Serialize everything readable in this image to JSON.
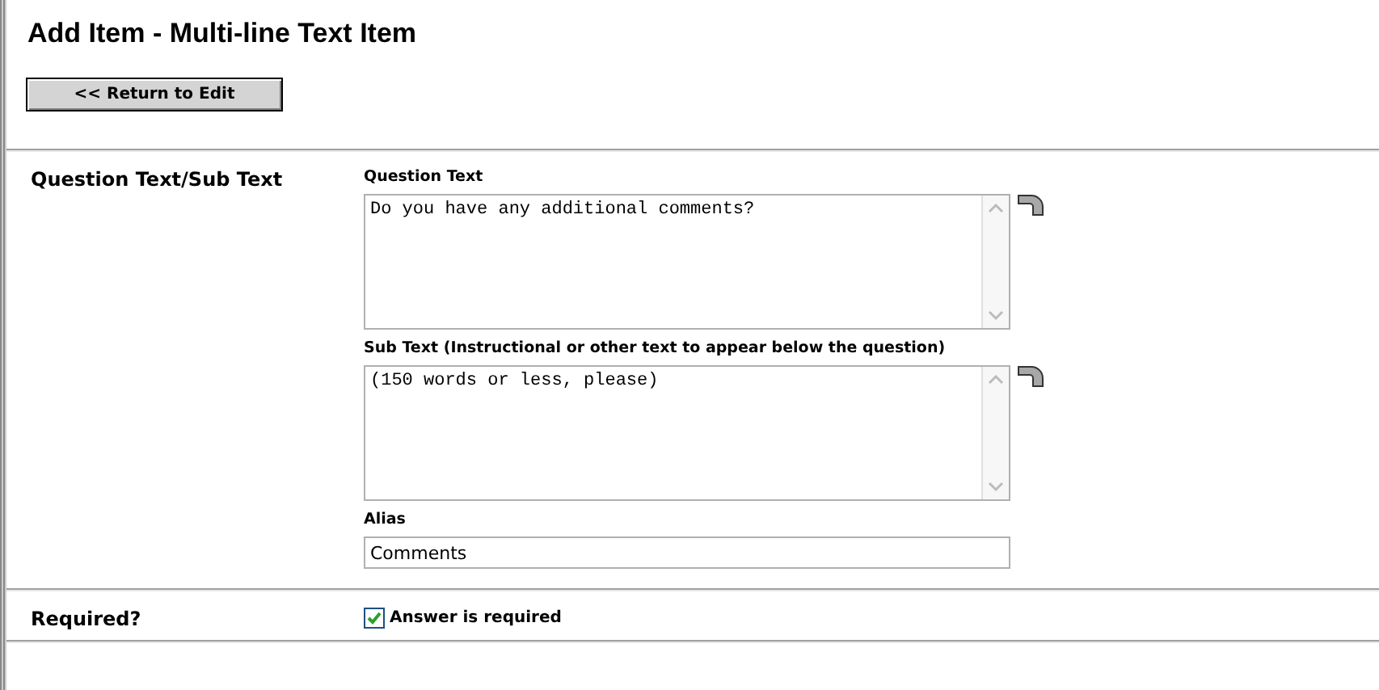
{
  "title": "Add Item - Multi-line Text Item",
  "return_button": "<< Return to Edit",
  "sections": [
    {
      "label": "Question Text/Sub Text",
      "fields": [
        {
          "kind": "textarea",
          "label": "Question Text",
          "value": "Do you have any additional comments?"
        },
        {
          "kind": "textarea",
          "label": "Sub Text (Instructional or other text to appear below the question)",
          "value": "(150 words or less, please)"
        },
        {
          "kind": "input",
          "label": "Alias",
          "value": "Comments"
        }
      ]
    },
    {
      "label": "Required?",
      "fields": [
        {
          "kind": "checkbox",
          "label": "Answer is required",
          "checked": true
        }
      ]
    }
  ]
}
